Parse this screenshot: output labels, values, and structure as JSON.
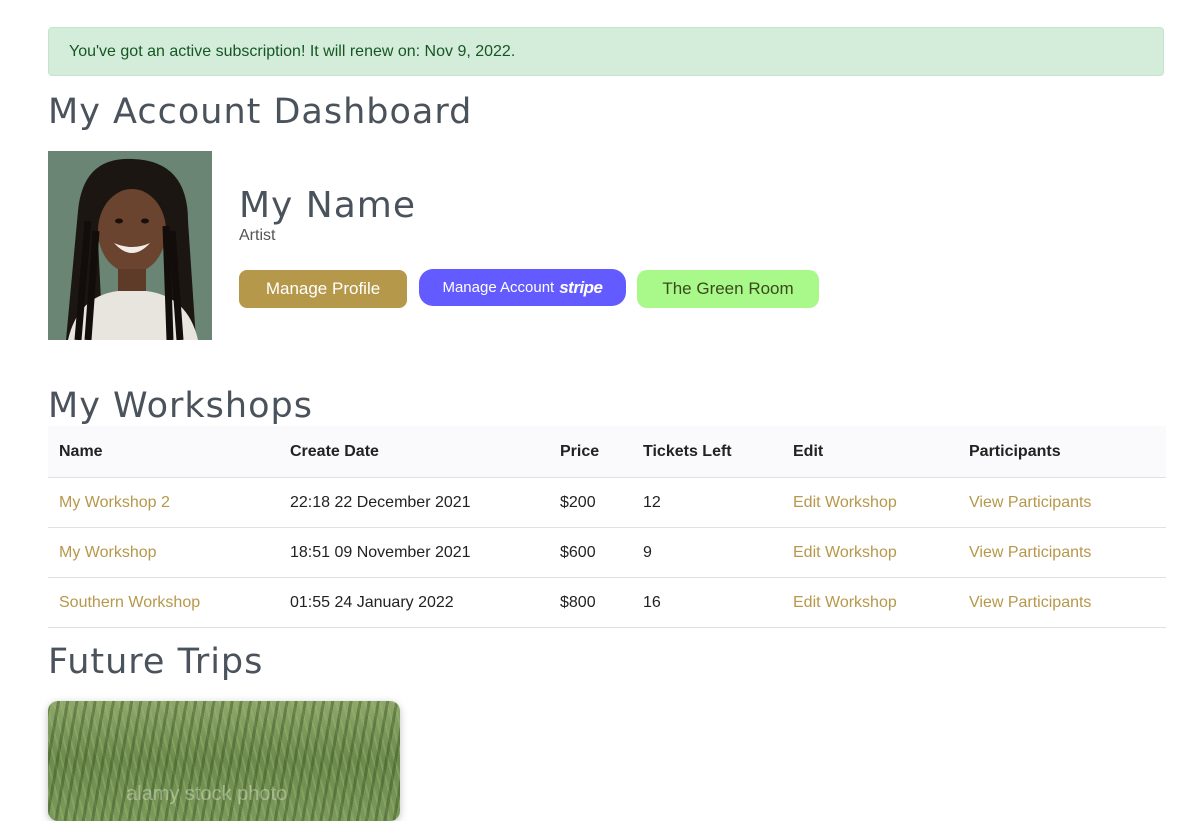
{
  "alert": {
    "text": "You've got an active subscription! It will renew on: Nov 9, 2022."
  },
  "page_title": "My Account Dashboard",
  "profile": {
    "name": "My Name",
    "role": "Artist",
    "buttons": {
      "manage_profile": "Manage Profile",
      "manage_account": "Manage Account",
      "stripe_logo": "stripe",
      "green_room": "The Green Room"
    }
  },
  "workshops": {
    "title": "My Workshops",
    "columns": [
      "Name",
      "Create Date",
      "Price",
      "Tickets Left",
      "Edit",
      "Participants"
    ],
    "rows": [
      {
        "name": "My Workshop 2",
        "create_date": "22:18 22 December 2021",
        "price": "$200",
        "tickets_left": "12",
        "edit": "Edit Workshop",
        "participants": "View Participants"
      },
      {
        "name": "My Workshop",
        "create_date": "18:51 09 November 2021",
        "price": "$600",
        "tickets_left": "9",
        "edit": "Edit Workshop",
        "participants": "View Participants"
      },
      {
        "name": "Southern Workshop",
        "create_date": "01:55 24 January 2022",
        "price": "$800",
        "tickets_left": "16",
        "edit": "Edit Workshop",
        "participants": "View Participants"
      }
    ]
  },
  "trips": {
    "title": "Future Trips",
    "watermark": "alamy stock photo"
  },
  "colors": {
    "accent_gold": "#b6984a",
    "stripe_purple": "#635bff",
    "green_room": "#a8f88a",
    "alert_bg": "#d4edda"
  }
}
